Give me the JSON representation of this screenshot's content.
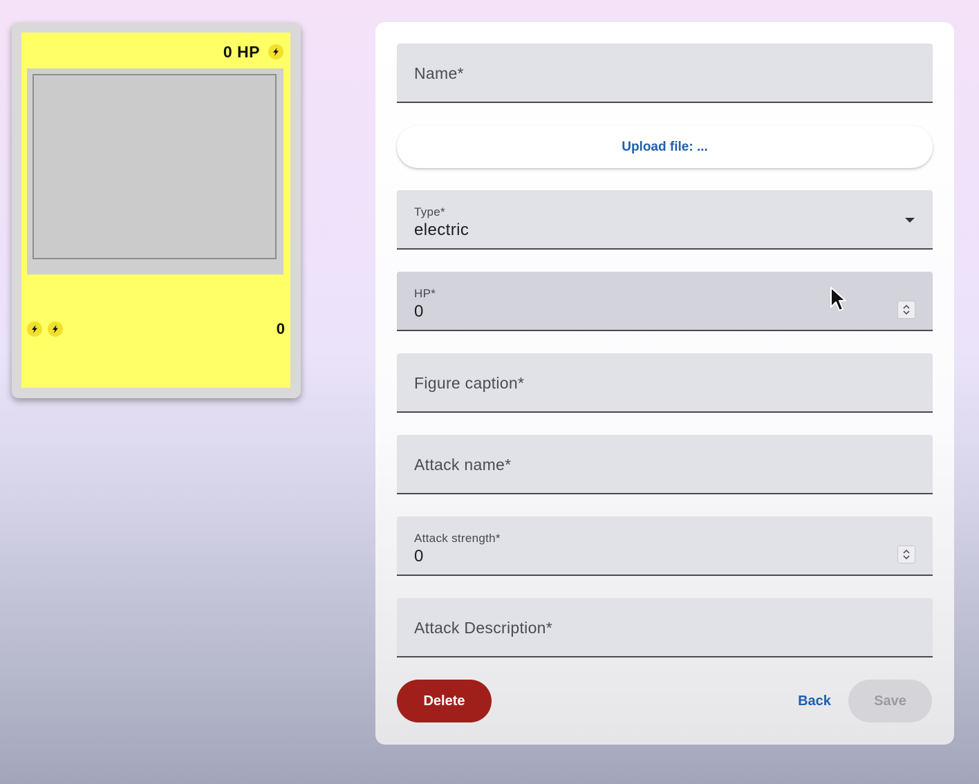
{
  "card": {
    "hp_text": "0 HP",
    "type_icon": "lightning-bolt-icon",
    "attack_cost_icons": [
      "lightning-bolt-icon",
      "lightning-bolt-icon"
    ],
    "attack_strength": "0",
    "colors": {
      "card_background": "#ffff66",
      "card_border": "#d9d9d9"
    }
  },
  "form": {
    "name": {
      "placeholder": "Name*"
    },
    "upload": {
      "label": "Upload file: ..."
    },
    "type": {
      "label": "Type*",
      "value": "electric"
    },
    "hp": {
      "label": "HP*",
      "value": "0"
    },
    "figure_caption": {
      "placeholder": "Figure caption*"
    },
    "attack_name": {
      "placeholder": "Attack name*"
    },
    "attack_strength": {
      "label": "Attack strength*",
      "value": "0"
    },
    "attack_description": {
      "placeholder": "Attack Description*"
    },
    "buttons": {
      "delete": "Delete",
      "back": "Back",
      "save": "Save"
    },
    "colors": {
      "delete": "#a11f1a",
      "link": "#1f5fae",
      "save_disabled": "#d5d5d9"
    }
  }
}
